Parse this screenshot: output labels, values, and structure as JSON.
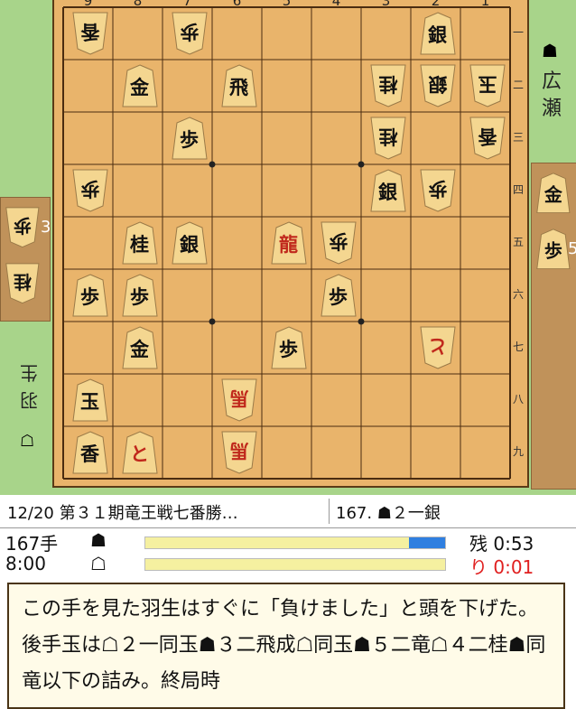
{
  "players": {
    "sente_mark": "☗",
    "sente_name": "広瀬",
    "gote_mark": "☖",
    "gote_name": "羽生"
  },
  "board": {
    "col_labels": [
      "9",
      "8",
      "7",
      "6",
      "5",
      "4",
      "3",
      "2",
      "1"
    ],
    "row_labels": [
      "一",
      "二",
      "三",
      "四",
      "五",
      "六",
      "七",
      "八",
      "九"
    ],
    "pieces": [
      {
        "square": "91",
        "char": "香",
        "side": "gote"
      },
      {
        "square": "71",
        "char": "歩",
        "side": "gote"
      },
      {
        "square": "21",
        "char": "銀",
        "side": "sente"
      },
      {
        "square": "82",
        "char": "金",
        "side": "sente"
      },
      {
        "square": "62",
        "char": "飛",
        "side": "sente"
      },
      {
        "square": "32",
        "char": "桂",
        "side": "gote"
      },
      {
        "square": "22",
        "char": "銀",
        "side": "gote"
      },
      {
        "square": "12",
        "char": "玉",
        "side": "gote"
      },
      {
        "square": "73",
        "char": "歩",
        "side": "sente"
      },
      {
        "square": "33",
        "char": "桂",
        "side": "gote"
      },
      {
        "square": "13",
        "char": "香",
        "side": "gote"
      },
      {
        "square": "94",
        "char": "歩",
        "side": "gote"
      },
      {
        "square": "34",
        "char": "銀",
        "side": "sente"
      },
      {
        "square": "24",
        "char": "歩",
        "side": "gote"
      },
      {
        "square": "85",
        "char": "桂",
        "side": "sente"
      },
      {
        "square": "75",
        "char": "銀",
        "side": "sente"
      },
      {
        "square": "55",
        "char": "龍",
        "side": "sente",
        "promoted": true
      },
      {
        "square": "45",
        "char": "歩",
        "side": "gote"
      },
      {
        "square": "96",
        "char": "歩",
        "side": "sente"
      },
      {
        "square": "86",
        "char": "歩",
        "side": "sente"
      },
      {
        "square": "46",
        "char": "歩",
        "side": "sente"
      },
      {
        "square": "87",
        "char": "金",
        "side": "sente"
      },
      {
        "square": "57",
        "char": "歩",
        "side": "sente"
      },
      {
        "square": "27",
        "char": "と",
        "side": "gote",
        "promoted": true
      },
      {
        "square": "98",
        "char": "玉",
        "side": "sente"
      },
      {
        "square": "68",
        "char": "馬",
        "side": "gote",
        "promoted": true
      },
      {
        "square": "99",
        "char": "香",
        "side": "sente"
      },
      {
        "square": "89",
        "char": "と",
        "side": "sente",
        "promoted": true
      },
      {
        "square": "69",
        "char": "馬",
        "side": "gote",
        "promoted": true
      }
    ]
  },
  "hands": {
    "gote": [
      {
        "char": "歩",
        "count": "3"
      },
      {
        "char": "桂",
        "count": ""
      }
    ],
    "sente": [
      {
        "char": "金",
        "count": ""
      },
      {
        "char": "歩",
        "count": "5"
      }
    ]
  },
  "info": {
    "game_title": "12/20 第３１期竜王戦七番勝…",
    "move_text": "167. ☗２一銀"
  },
  "status": {
    "move_count": "167手",
    "time_total": "8:00",
    "sente_mark": "☗",
    "gote_mark": "☖",
    "remaining_label": "残 0:53",
    "byoyomi_label": "り 0:01",
    "sente_bar_fraction": 0.88,
    "gote_bar_fraction": 1.0
  },
  "comment": "この手を見た羽生はすぐに「負けました」と頭を下げた。後手玉は☖２一同玉☗３二飛成☖同玉☗５二竜☖４二桂☗同竜以下の詰み。終局時"
}
